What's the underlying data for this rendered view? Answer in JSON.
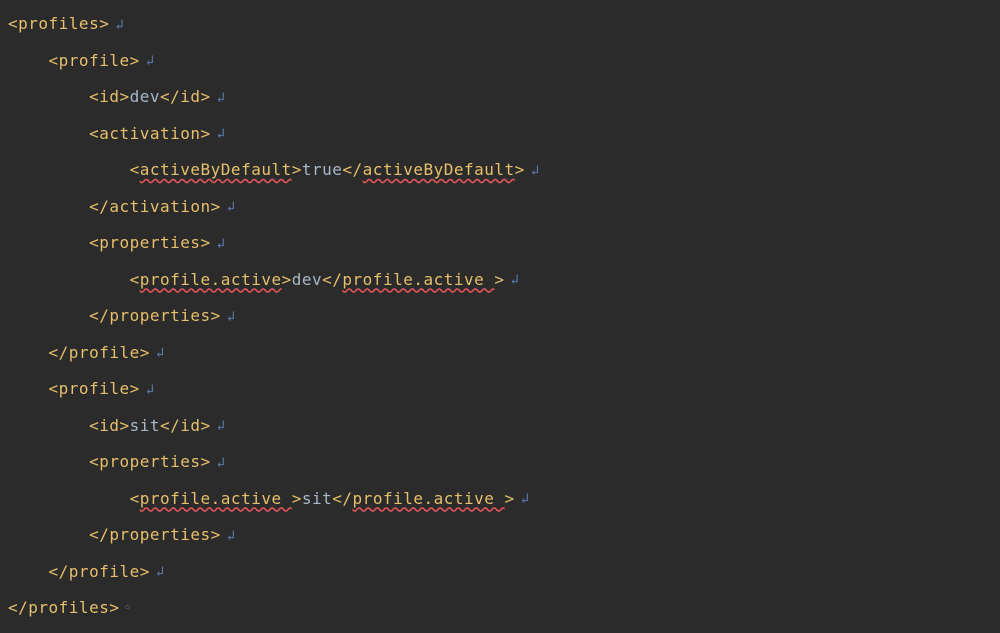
{
  "glyphs": {
    "newline": "↲",
    "caret": "◦"
  },
  "code": {
    "lines": [
      [
        {
          "cls": "tag",
          "text": "<profiles>"
        },
        {
          "cls": "arrow",
          "bind": "glyphs.newline"
        }
      ],
      [
        {
          "cls": "",
          "text": "    "
        },
        {
          "cls": "tag",
          "text": "<profile>"
        },
        {
          "cls": "arrow",
          "bind": "glyphs.newline"
        }
      ],
      [
        {
          "cls": "",
          "text": "        "
        },
        {
          "cls": "tag",
          "text": "<id>"
        },
        {
          "cls": "text",
          "text": "dev"
        },
        {
          "cls": "tag",
          "text": "</id>"
        },
        {
          "cls": "arrow",
          "bind": "glyphs.newline"
        }
      ],
      [
        {
          "cls": "",
          "text": "        "
        },
        {
          "cls": "tag",
          "text": "<activation>"
        },
        {
          "cls": "arrow",
          "bind": "glyphs.newline"
        }
      ],
      [
        {
          "cls": "",
          "text": "            "
        },
        {
          "cls": "tag",
          "text": "<"
        },
        {
          "cls": "tag err",
          "text": "activeByDefault"
        },
        {
          "cls": "tag",
          "text": ">"
        },
        {
          "cls": "text",
          "text": "true"
        },
        {
          "cls": "tag",
          "text": "</"
        },
        {
          "cls": "tag err",
          "text": "activeByDefault"
        },
        {
          "cls": "tag",
          "text": ">"
        },
        {
          "cls": "arrow",
          "bind": "glyphs.newline"
        }
      ],
      [
        {
          "cls": "",
          "text": "        "
        },
        {
          "cls": "tag",
          "text": "</activation>"
        },
        {
          "cls": "arrow",
          "bind": "glyphs.newline"
        }
      ],
      [
        {
          "cls": "",
          "text": "        "
        },
        {
          "cls": "tag",
          "text": "<properties>"
        },
        {
          "cls": "arrow",
          "bind": "glyphs.newline"
        }
      ],
      [
        {
          "cls": "",
          "text": "            "
        },
        {
          "cls": "tag",
          "text": "<"
        },
        {
          "cls": "tag err",
          "text": "profile.active"
        },
        {
          "cls": "tag",
          "text": ">"
        },
        {
          "cls": "text",
          "text": "dev"
        },
        {
          "cls": "tag",
          "text": "</"
        },
        {
          "cls": "tag err",
          "text": "profile.active "
        },
        {
          "cls": "tag",
          "text": ">"
        },
        {
          "cls": "arrow",
          "bind": "glyphs.newline"
        }
      ],
      [
        {
          "cls": "",
          "text": "        "
        },
        {
          "cls": "tag",
          "text": "</properties>"
        },
        {
          "cls": "arrow",
          "bind": "glyphs.newline"
        }
      ],
      [
        {
          "cls": "",
          "text": "    "
        },
        {
          "cls": "tag",
          "text": "</profile>"
        },
        {
          "cls": "arrow",
          "bind": "glyphs.newline"
        }
      ],
      [
        {
          "cls": "",
          "text": "    "
        },
        {
          "cls": "tag",
          "text": "<profile>"
        },
        {
          "cls": "arrow",
          "bind": "glyphs.newline"
        }
      ],
      [
        {
          "cls": "",
          "text": "        "
        },
        {
          "cls": "tag",
          "text": "<id>"
        },
        {
          "cls": "text",
          "text": "sit"
        },
        {
          "cls": "tag",
          "text": "</id>"
        },
        {
          "cls": "arrow",
          "bind": "glyphs.newline"
        }
      ],
      [
        {
          "cls": "",
          "text": "        "
        },
        {
          "cls": "tag",
          "text": "<properties>"
        },
        {
          "cls": "arrow",
          "bind": "glyphs.newline"
        }
      ],
      [
        {
          "cls": "",
          "text": "            "
        },
        {
          "cls": "tag",
          "text": "<"
        },
        {
          "cls": "tag err",
          "text": "profile.active "
        },
        {
          "cls": "tag",
          "text": ">"
        },
        {
          "cls": "text",
          "text": "sit"
        },
        {
          "cls": "tag",
          "text": "</"
        },
        {
          "cls": "tag err",
          "text": "profile.active "
        },
        {
          "cls": "tag",
          "text": ">"
        },
        {
          "cls": "arrow",
          "bind": "glyphs.newline"
        }
      ],
      [
        {
          "cls": "",
          "text": "        "
        },
        {
          "cls": "tag",
          "text": "</properties>"
        },
        {
          "cls": "arrow",
          "bind": "glyphs.newline"
        }
      ],
      [
        {
          "cls": "",
          "text": "    "
        },
        {
          "cls": "tag",
          "text": "</profile>"
        },
        {
          "cls": "arrow",
          "bind": "glyphs.newline"
        }
      ],
      [
        {
          "cls": "tag",
          "text": "</profiles>"
        },
        {
          "cls": "caret",
          "bind": "glyphs.caret"
        }
      ]
    ]
  }
}
